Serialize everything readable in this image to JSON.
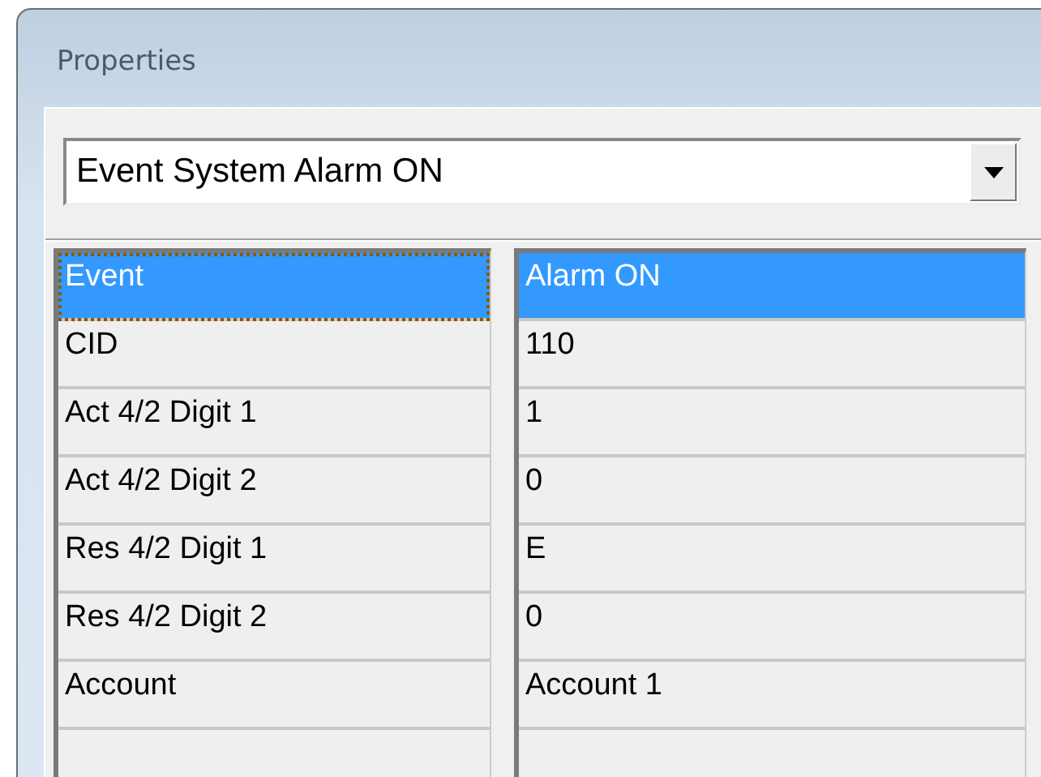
{
  "window": {
    "title": "Properties"
  },
  "selector": {
    "value": "Event System Alarm ON"
  },
  "properties": [
    {
      "name": "Event",
      "value": "Alarm ON",
      "selected": true
    },
    {
      "name": "CID",
      "value": "110",
      "selected": false
    },
    {
      "name": "Act 4/2 Digit 1",
      "value": "1",
      "selected": false
    },
    {
      "name": "Act 4/2 Digit 2",
      "value": "0",
      "selected": false
    },
    {
      "name": "Res 4/2 Digit 1",
      "value": "E",
      "selected": false
    },
    {
      "name": "Res 4/2 Digit 2",
      "value": "0",
      "selected": false
    },
    {
      "name": "Account",
      "value": "Account 1",
      "selected": false
    }
  ]
}
